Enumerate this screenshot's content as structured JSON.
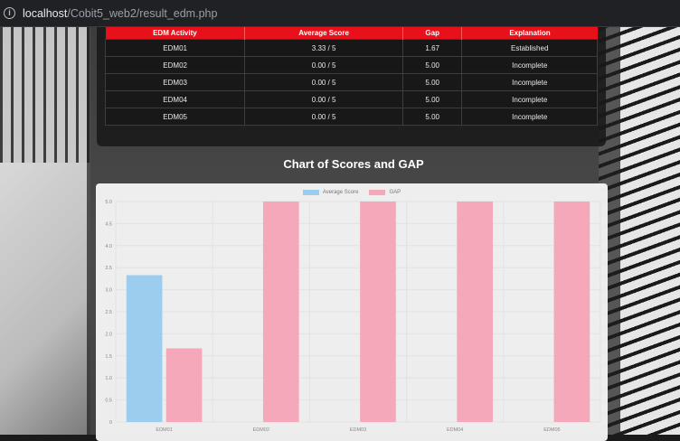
{
  "browser": {
    "url_host": "localhost",
    "url_path": "/Cobit5_web2/result_edm.php"
  },
  "table": {
    "headers": [
      "EDM Activity",
      "Average Score",
      "Gap",
      "Explanation"
    ],
    "rows": [
      [
        "EDM01",
        "3.33 / 5",
        "1.67",
        "Established"
      ],
      [
        "EDM02",
        "0.00 / 5",
        "5.00",
        "Incomplete"
      ],
      [
        "EDM03",
        "0.00 / 5",
        "5.00",
        "Incomplete"
      ],
      [
        "EDM04",
        "0.00 / 5",
        "5.00",
        "Incomplete"
      ],
      [
        "EDM05",
        "0.00 / 5",
        "5.00",
        "Incomplete"
      ]
    ]
  },
  "colors": {
    "header_red": "#e8101a",
    "average_score": "#9ccdee",
    "gap": "#f4a8b9"
  },
  "chart_data": {
    "type": "bar",
    "title": "Chart of Scores and GAP",
    "categories": [
      "EDM01",
      "EDM02",
      "EDM03",
      "EDM04",
      "EDM05"
    ],
    "series": [
      {
        "name": "Average Score",
        "values": [
          3.33,
          0,
          0,
          0,
          0
        ]
      },
      {
        "name": "GAP",
        "values": [
          1.67,
          5,
          5,
          5,
          5
        ]
      }
    ],
    "ylim": [
      0,
      5
    ],
    "yticks": [
      "0",
      "0.5",
      "1.0",
      "1.5",
      "2.0",
      "2.5",
      "3.0",
      "3.5",
      "4.0",
      "4.5",
      "5.0"
    ],
    "legend_position": "top",
    "grid": true
  }
}
